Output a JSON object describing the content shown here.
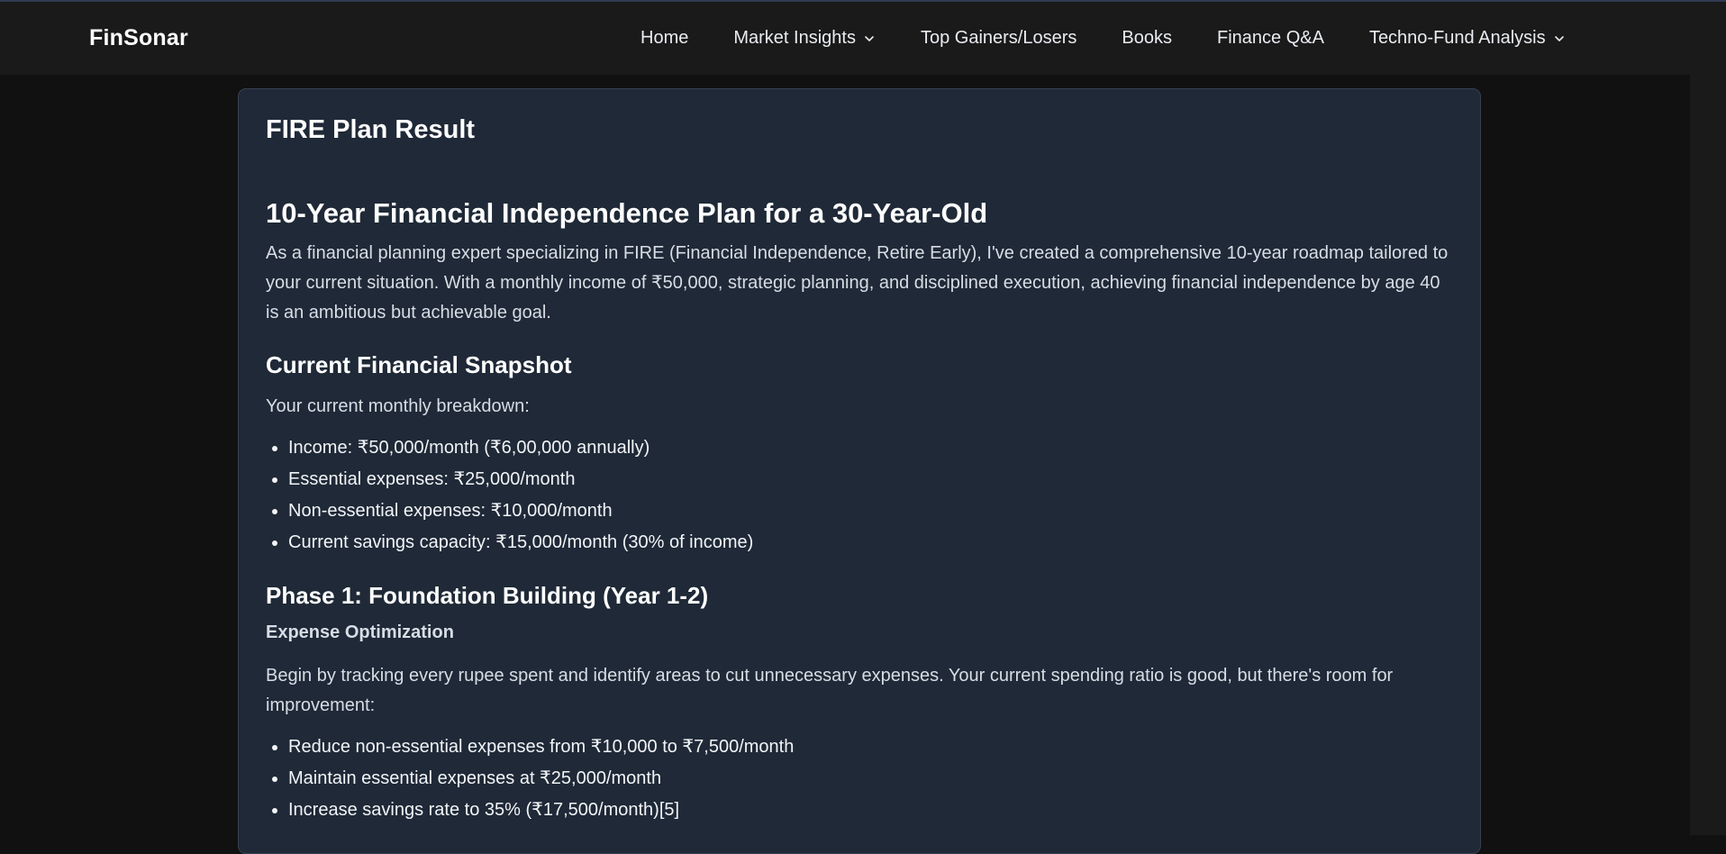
{
  "nav": {
    "brand": "FinSonar",
    "links": [
      {
        "label": "Home",
        "dropdown": false
      },
      {
        "label": "Market Insights",
        "dropdown": true
      },
      {
        "label": "Top Gainers/Losers",
        "dropdown": false
      },
      {
        "label": "Books",
        "dropdown": false
      },
      {
        "label": "Finance Q&A",
        "dropdown": false
      },
      {
        "label": "Techno-Fund Analysis",
        "dropdown": true
      }
    ]
  },
  "card": {
    "title": "FIRE Plan Result",
    "heading": "10-Year Financial Independence Plan for a 30-Year-Old",
    "intro": "As a financial planning expert specializing in FIRE (Financial Independence, Retire Early), I've created a comprehensive 10-year roadmap tailored to your current situation. With a monthly income of ₹50,000, strategic planning, and disciplined execution, achieving financial independence by age 40 is an ambitious but achievable goal.",
    "snapshot": {
      "heading": "Current Financial Snapshot",
      "lead": "Your current monthly breakdown:",
      "items": [
        "Income: ₹50,000/month (₹6,00,000 annually)",
        "Essential expenses: ₹25,000/month",
        "Non-essential expenses: ₹10,000/month",
        "Current savings capacity: ₹15,000/month (30% of income)"
      ]
    },
    "phase1": {
      "heading": "Phase 1: Foundation Building (Year 1-2)",
      "subheading": "Expense Optimization",
      "text": "Begin by tracking every rupee spent and identify areas to cut unnecessary expenses. Your current spending ratio is good, but there's room for improvement:",
      "items": [
        "Reduce non-essential expenses from ₹10,000 to ₹7,500/month",
        "Maintain essential expenses at ₹25,000/month",
        "Increase savings rate to 35% (₹17,500/month)[5]"
      ]
    }
  }
}
